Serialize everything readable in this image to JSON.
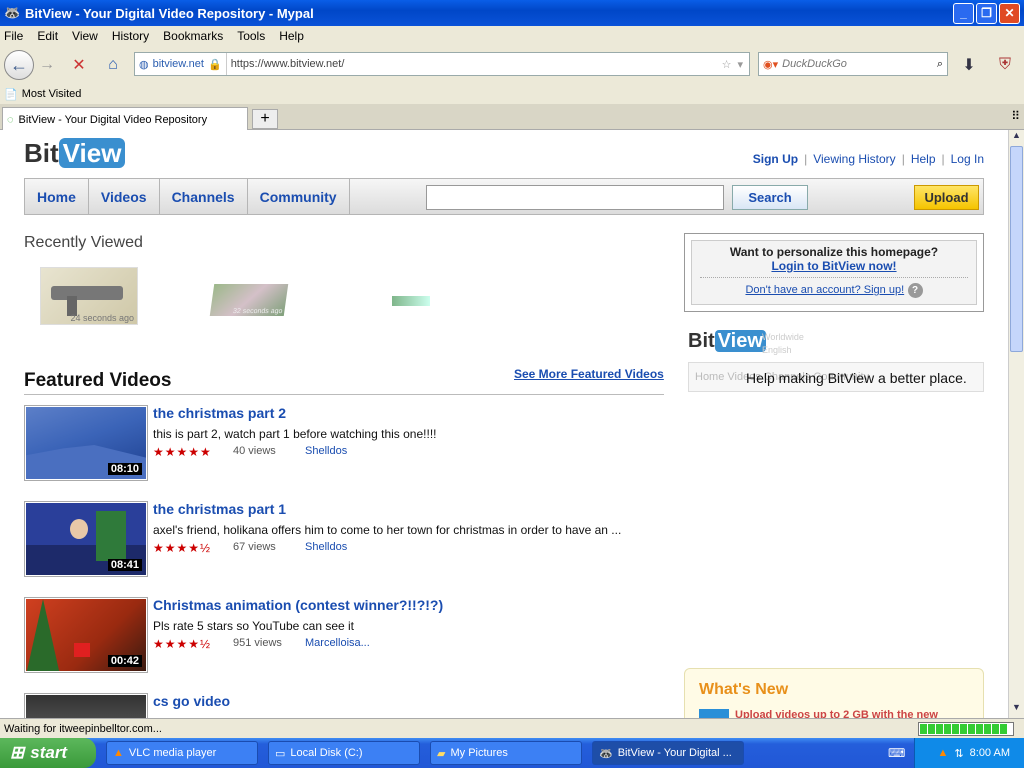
{
  "window": {
    "title": "BitView - Your Digital Video Repository - Mypal"
  },
  "menu": [
    "File",
    "Edit",
    "View",
    "History",
    "Bookmarks",
    "Tools",
    "Help"
  ],
  "url": {
    "site": "bitview.net",
    "address": "https://www.bitview.net/"
  },
  "search": {
    "placeholder": "DuckDuckGo"
  },
  "bookmarks": {
    "most_visited": "Most Visited"
  },
  "tab": {
    "title": "BitView - Your Digital Video Repository"
  },
  "page": {
    "logo": {
      "bit": "Bit",
      "view": "View"
    },
    "toplinks": {
      "signup": "Sign Up",
      "history": "Viewing History",
      "help": "Help",
      "login": "Log In"
    },
    "nav": [
      "Home",
      "Videos",
      "Channels",
      "Community"
    ],
    "search_button": "Search",
    "upload_button": "Upload",
    "recently_viewed": {
      "title": "Recently Viewed",
      "items": [
        {
          "time": "24 seconds ago"
        },
        {
          "time": "32 seconds ago"
        }
      ]
    },
    "personalize": {
      "question": "Want to personalize this homepage?",
      "login": "Login to BitView now!",
      "signup": "Don't have an account? Sign up!"
    },
    "mini": {
      "ghost_line1": "Worldwide",
      "ghost_line2": "English",
      "ghost_nav": "Home   Videos   Channels   Community"
    },
    "tooltip": "Help making BitView a better place.",
    "featured": {
      "title": "Featured Videos",
      "more": "See More Featured Videos",
      "videos": [
        {
          "title": "the christmas part 2",
          "desc": "this is part 2, watch part 1 before watching this one!!!!",
          "stars": "★★★★★",
          "rating": 5,
          "views": "40 views",
          "author": "Shelldos",
          "duration": "08:10"
        },
        {
          "title": "the christmas part 1",
          "desc": "axel's friend, holikana offers him to come to her town for christmas in order to have an ...",
          "stars": "★★★★½",
          "rating": 4.5,
          "views": "67 views",
          "author": "Shelldos",
          "duration": "08:41"
        },
        {
          "title": "Christmas animation (contest winner?!!?!?)",
          "desc": "Pls rate 5 stars so YouTube can see it",
          "stars": "★★★★½",
          "rating": 4.5,
          "views": "951 views",
          "author": "Marcelloisa...",
          "duration": "00:42"
        },
        {
          "title": "cs go video",
          "desc": "",
          "stars": "",
          "views": "",
          "author": "",
          "duration": ""
        }
      ]
    },
    "whats_new": {
      "title": "What's New",
      "item": "Upload videos up to 2 GB with the new"
    }
  },
  "status": {
    "text": "Waiting for itweepinbelltor.com...",
    "progress": 1.0
  },
  "taskbar": {
    "start": "start",
    "tasks": [
      "VLC media player",
      "Local Disk (C:)",
      "My Pictures",
      "BitView - Your Digital ..."
    ],
    "clock": "8:00 AM"
  }
}
